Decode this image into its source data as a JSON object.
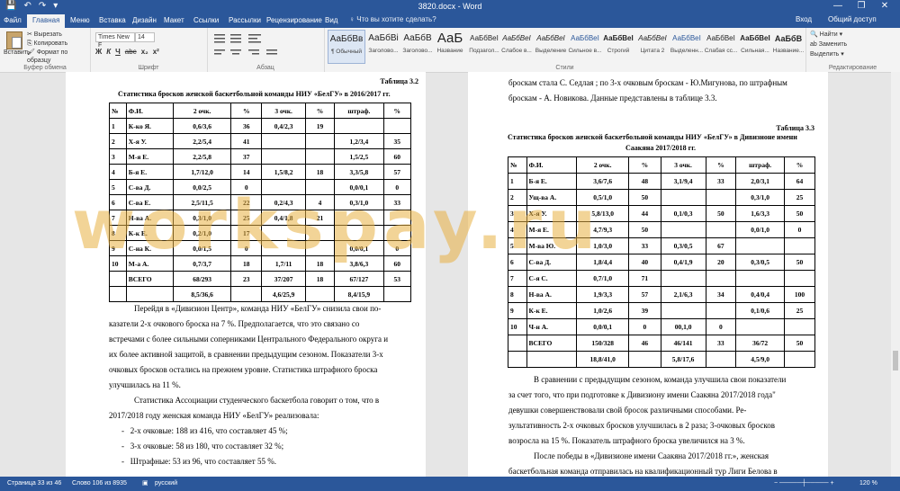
{
  "window": {
    "title": "3820.docx - Word",
    "quick_access": [
      "💾",
      "↶",
      "↷",
      "▾"
    ],
    "controls": [
      "—",
      "❐",
      "✕"
    ]
  },
  "tabs": {
    "file": "Файл",
    "items": [
      "Главная",
      "Меню",
      "Вставка",
      "Дизайн",
      "Макет",
      "Ссылки",
      "Рассылки",
      "Рецензирование",
      "Вид"
    ],
    "tell_me": "♀ Что вы хотите сделать?",
    "sign_in": "Вход",
    "share": "Общий доступ"
  },
  "ribbon": {
    "paste": "Вставить",
    "cut": "✂ Вырезать",
    "copy": "⎘ Копировать",
    "format_painter": "🖌 Формат по образцу",
    "clipboard_label": "Буфер обмена",
    "font_name": "Times New F",
    "font_size": "14",
    "font_label": "Шрифт",
    "format_buttons": [
      "Ж",
      "К",
      "Ч",
      "abc",
      "x₂",
      "x²"
    ],
    "para_label": "Абзац",
    "styles_label": "Стили",
    "styles": [
      {
        "preview": "АаБбВв",
        "name": "¶ Обычный"
      },
      {
        "preview": "АаБбВі",
        "name": "Заголово..."
      },
      {
        "preview": "АаБбВ",
        "name": "Заголово..."
      },
      {
        "preview": "АаБ",
        "name": "Название"
      },
      {
        "preview": "АаБбВеІ",
        "name": "Подзагол..."
      },
      {
        "preview": "АаБбВеІ",
        "name": "Слабое в..."
      },
      {
        "preview": "АаБбВеІ",
        "name": "Выделение"
      },
      {
        "preview": "АаБбВеІ",
        "name": "Сильное в..."
      },
      {
        "preview": "АаБбВеІ",
        "name": "Строгий"
      },
      {
        "preview": "АаБбВеІ",
        "name": "Цитата 2"
      },
      {
        "preview": "АаБбВеІ",
        "name": "Выделенн..."
      },
      {
        "preview": "АаБбВеІ",
        "name": "Слабая сс..."
      },
      {
        "preview": "АаБбВеІ",
        "name": "Сильная..."
      },
      {
        "preview": "АаБбВ",
        "name": "Название..."
      }
    ],
    "find": "🔍 Найти ▾",
    "replace": "ab Заменить",
    "select": "Выделить ▾",
    "editing_label": "Редактирование"
  },
  "page1": {
    "table_no": "Таблица 3.2",
    "title": "Статистика бросков женской баскетбольной команды НИУ «БелГУ» в 2016/2017 гг.",
    "header": [
      "№",
      "Ф.И.",
      "2 очк.",
      "%",
      "3 очк.",
      "%",
      "штраф.",
      "%"
    ],
    "rows": [
      [
        "1",
        "К-ко Я.",
        "0,6/3,6",
        "36",
        "0,4/2,3",
        "19",
        "",
        ""
      ],
      [
        "2",
        "Х-я У.",
        "2,2/5,4",
        "41",
        "",
        "",
        "1,2/3,4",
        "35"
      ],
      [
        "3",
        "М-я Е.",
        "2,2/5,8",
        "37",
        "",
        "",
        "1,5/2,5",
        "60"
      ],
      [
        "4",
        "Б-я Е.",
        "1,7/12,0",
        "14",
        "1,5/8,2",
        "18",
        "3,3/5,8",
        "57"
      ],
      [
        "5",
        "С-ва Д.",
        "0,0/2,5",
        "0",
        "",
        "",
        "0,0/0,1",
        "0"
      ],
      [
        "6",
        "С-ва Е.",
        "2,5/11,5",
        "22",
        "0,2/4,3",
        "4",
        "0,3/1,0",
        "33"
      ],
      [
        "7",
        "Н-ва А.",
        "0,3/1,0",
        "25",
        "0,4/1,8",
        "21",
        "",
        ""
      ],
      [
        "8",
        "К-к Е.",
        "0,2/1,0",
        "17",
        "",
        "",
        "",
        ""
      ],
      [
        "9",
        "С-на К.",
        "0,0/1,5",
        "0",
        "",
        "",
        "0,0/0,1",
        "0"
      ],
      [
        "10",
        "М-а А.",
        "0,7/3,7",
        "18",
        "1,7/11",
        "18",
        "3,8/6,3",
        "60"
      ],
      [
        "",
        "ВСЕГО",
        "68/293",
        "23",
        "37/207",
        "18",
        "67/127",
        "53"
      ],
      [
        "",
        "",
        "8,5/36,6",
        "",
        "4,6/25,9",
        "",
        "8,4/15,9",
        ""
      ]
    ],
    "paragraphs": [
      "Перейдя в «Дивизион Центр», команда НИУ «БелГУ» снизила свои по-",
      "казатели 2-х очкового броска на 7 %. Предполагается, что это связано со",
      "встречами с более сильными соперниками Центрального Федерального округа и",
      "их более активной защитой, в сравнении предыдущим сезоном. Показатели 3-х",
      "очковых бросков остались на прежнем уровне. Статистика штрафного броска",
      "улучшилась на 11 %.",
      "Статистика Ассоциации студенческого баскетбола говорит о том, что в",
      "2017/2018 году женская команда НИУ «БелГУ» реализовала:"
    ],
    "list": [
      "2-х очковые: 188 из 416, что составляет 45 %;",
      "3-х очковые: 58 из 180, что составляет 32 %;",
      "Штрафные: 53 из 96, что составляет 55 %."
    ]
  },
  "page2": {
    "intro": "броскам стала С. Седлая ; по 3-х очковым броскам - Ю.Мигунова, по штрафным",
    "intro2": "броскам - А. Новикова. Данные представлены в таблице 3.3.",
    "table_no": "Таблица 3.3",
    "title1": "Статистика бросков женской баскетбольной команды НИУ «БелГУ» в Дивизионе имени",
    "title2": "Саакяна 2017/2018 гг.",
    "header": [
      "№",
      "Ф.И.",
      "2 очк.",
      "%",
      "3 очк.",
      "%",
      "штраф.",
      "%"
    ],
    "rows": [
      [
        "1",
        "Б-я Е.",
        "3,6/7,6",
        "48",
        "3,1/9,4",
        "33",
        "2,0/3,1",
        "64"
      ],
      [
        "2",
        "Ущ-ва А.",
        "0,5/1,0",
        "50",
        "",
        "",
        "0,3/1,0",
        "25"
      ],
      [
        "3",
        "Х-я У.",
        "5,8/13,0",
        "44",
        "0,1/0,3",
        "50",
        "1,6/3,3",
        "50"
      ],
      [
        "4",
        "М-я Е.",
        "4,7/9,3",
        "50",
        "",
        "",
        "0,0/1,0",
        "0"
      ],
      [
        "5",
        "М-ва Ю.",
        "1,0/3,0",
        "33",
        "0,3/0,5",
        "67",
        "",
        ""
      ],
      [
        "6",
        "С-ва Д.",
        "1,8/4,4",
        "40",
        "0,4/1,9",
        "20",
        "0,3/0,5",
        "50"
      ],
      [
        "7",
        "С-я С.",
        "0,7/1,0",
        "71",
        "",
        "",
        "",
        ""
      ],
      [
        "8",
        "Н-ва А.",
        "1,9/3,3",
        "57",
        "2,1/6,3",
        "34",
        "0,4/0,4",
        "100"
      ],
      [
        "9",
        "К-к Е.",
        "1,0/2,6",
        "39",
        "",
        "",
        "0,1/0,6",
        "25"
      ],
      [
        "10",
        "Ч-н А.",
        "0,0/0,1",
        "0",
        "00,1,0",
        "0",
        "",
        ""
      ],
      [
        "",
        "ВСЕГО",
        "150/328",
        "46",
        "46/141",
        "33",
        "36/72",
        "50"
      ],
      [
        "",
        "",
        "18,8/41,0",
        "",
        "5,8/17,6",
        "",
        "4,5/9,0",
        ""
      ]
    ],
    "paragraphs": [
      "В сравнении с предыдущим сезоном, команда улучшила свои показатели",
      "за счет того, что при подготовке к Дивизиону имени Саакяна 2017/2018 года\"",
      "девушки совершенствовали свой бросок различными способами. Ре-",
      "зультативность 2-х очковых бросков улучшилась в 2 раза; 3-очковых бросков",
      "возросла на 15 %. Показатель штрафного броска увеличился на 3 %.",
      "После победы в «Дивизионе имени Саакяна 2017/2018 гг.», женская",
      "баскетбольная команда отправилась на квалификационный тур Лиги Белова в"
    ]
  },
  "watermark": "workspay.ru",
  "status": {
    "page": "Страница 33 из 46",
    "words": "Слово 106 из 8935",
    "lang": "русский",
    "zoom": "120 %"
  },
  "colors": {
    "accent": "#2b579a",
    "watermark": "#e8b143"
  }
}
